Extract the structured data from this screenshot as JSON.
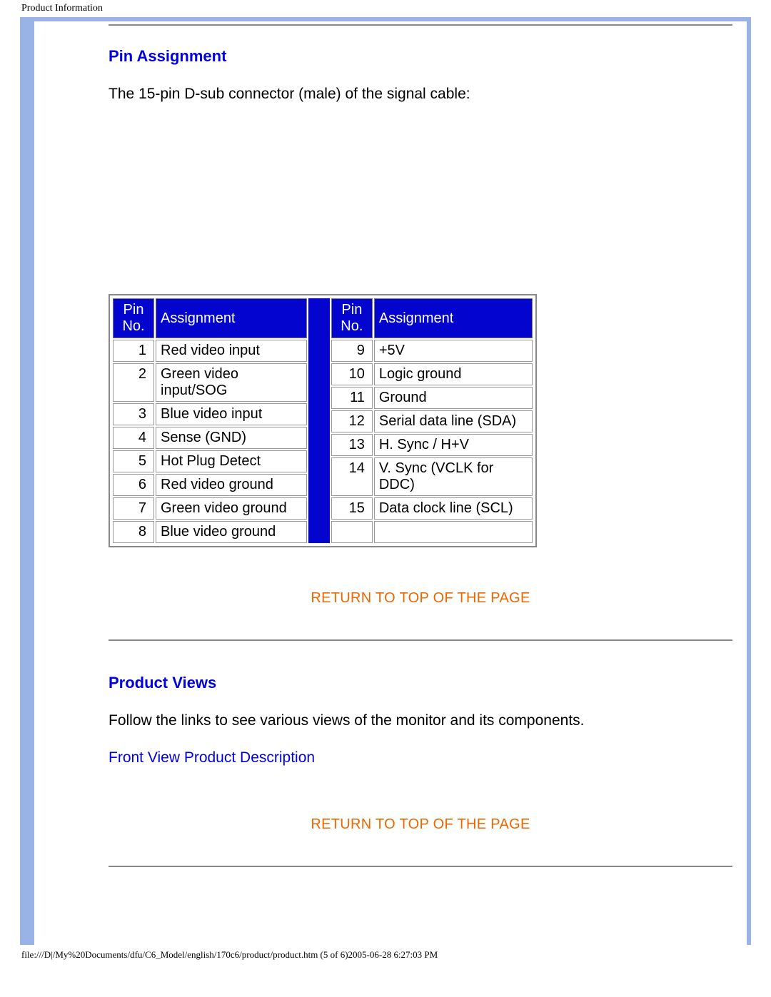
{
  "header": "Product Information",
  "section1": {
    "title": "Pin Assignment",
    "intro": "The 15-pin D-sub connector (male) of the signal cable:"
  },
  "table_headers": {
    "pin": "Pin No.",
    "assign": "Assignment"
  },
  "pins_left": [
    {
      "n": "1",
      "a": "Red video input"
    },
    {
      "n": "2",
      "a": "Green video input/SOG"
    },
    {
      "n": "3",
      "a": "Blue video input"
    },
    {
      "n": "4",
      "a": "Sense (GND)"
    },
    {
      "n": "5",
      "a": "Hot Plug Detect"
    },
    {
      "n": "6",
      "a": "Red video ground"
    },
    {
      "n": "7",
      "a": "Green video ground"
    },
    {
      "n": "8",
      "a": "Blue video ground"
    }
  ],
  "pins_right": [
    {
      "n": "9",
      "a": "+5V"
    },
    {
      "n": "10",
      "a": "Logic ground"
    },
    {
      "n": "11",
      "a": "Ground"
    },
    {
      "n": "12",
      "a": "Serial data line (SDA)"
    },
    {
      "n": "13",
      "a": "H. Sync / H+V"
    },
    {
      "n": "14",
      "a": "V. Sync (VCLK for DDC)"
    },
    {
      "n": "15",
      "a": "Data clock line (SCL)"
    },
    {
      "n": "",
      "a": ""
    }
  ],
  "return_link": "RETURN TO TOP OF THE PAGE",
  "section2": {
    "title": "Product Views",
    "intro": "Follow the links to see various views of the monitor and its components.",
    "link": "Front View Product Description"
  },
  "footer": "file:///D|/My%20Documents/dfu/C6_Model/english/170c6/product/product.htm (5 of 6)2005-06-28 6:27:03 PM"
}
